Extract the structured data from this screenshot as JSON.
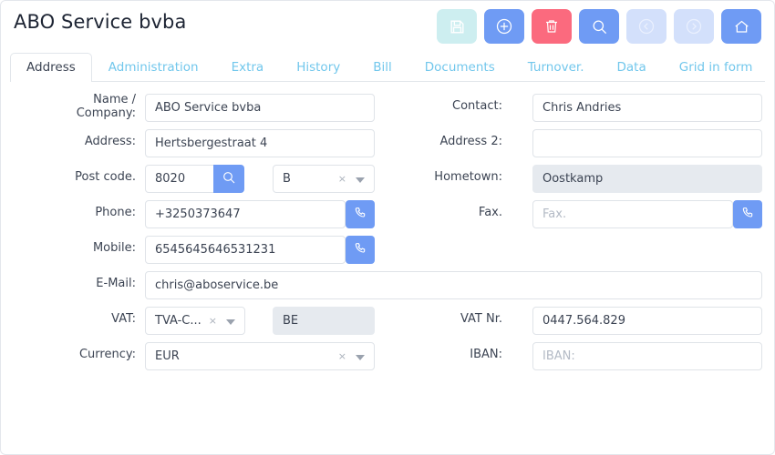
{
  "header": {
    "title": "ABO Service bvba"
  },
  "toolbar": {
    "buttons": [
      {
        "name": "save-button",
        "icon": "save-icon",
        "label": "Save",
        "state": "disabled"
      },
      {
        "name": "add-button",
        "icon": "plus-circle-icon",
        "label": "Add",
        "state": "enabled"
      },
      {
        "name": "delete-button",
        "icon": "trash-icon",
        "label": "Delete",
        "state": "enabled"
      },
      {
        "name": "search-button",
        "icon": "search-icon",
        "label": "Search",
        "state": "enabled"
      },
      {
        "name": "prev-button",
        "icon": "chevron-left-circle-icon",
        "label": "Previous",
        "state": "disabled"
      },
      {
        "name": "next-button",
        "icon": "chevron-right-circle-icon",
        "label": "Next",
        "state": "disabled"
      },
      {
        "name": "home-button",
        "icon": "home-icon",
        "label": "Home",
        "state": "enabled"
      }
    ]
  },
  "tabs": [
    {
      "label": "Address",
      "active": true
    },
    {
      "label": "Administration",
      "active": false
    },
    {
      "label": "Extra",
      "active": false
    },
    {
      "label": "History",
      "active": false
    },
    {
      "label": "Bill",
      "active": false
    },
    {
      "label": "Documents",
      "active": false
    },
    {
      "label": "Turnover.",
      "active": false
    },
    {
      "label": "Data",
      "active": false
    },
    {
      "label": "Grid in form",
      "active": false
    }
  ],
  "form": {
    "name_company": {
      "label_line1": "Name /",
      "label_line2": "Company:",
      "value": "ABO Service bvba",
      "placeholder": ""
    },
    "contact": {
      "label": "Contact:",
      "value": "Chris Andries",
      "placeholder": ""
    },
    "address": {
      "label": "Address:",
      "value": "Hertsbergestraat 4",
      "placeholder": ""
    },
    "address2": {
      "label": "Address 2:",
      "value": "",
      "placeholder": ""
    },
    "postcode": {
      "label": "Post code.",
      "value": "8020",
      "placeholder": "",
      "search_icon": "search-icon"
    },
    "country": {
      "label": "",
      "value": "B",
      "clear_glyph": "×"
    },
    "hometown": {
      "label": "Hometown:",
      "value": "Oostkamp",
      "readonly": true
    },
    "phone": {
      "label": "Phone:",
      "value": "+3250373647",
      "placeholder": "",
      "call_icon": "phone-icon"
    },
    "fax": {
      "label": "Fax.",
      "value": "",
      "placeholder": "Fax.",
      "call_icon": "phone-icon"
    },
    "mobile": {
      "label": "Mobile:",
      "value": "6545645646531231",
      "placeholder": "",
      "call_icon": "phone-icon"
    },
    "email": {
      "label": "E-Mail:",
      "value": "chris@aboservice.be",
      "placeholder": ""
    },
    "vat": {
      "label": "VAT:",
      "value": "TVA-C...",
      "clear_glyph": "×"
    },
    "vat_code": {
      "value": "BE",
      "readonly": true
    },
    "vat_nr": {
      "label": "VAT Nr.",
      "value": "0447.564.829",
      "placeholder": ""
    },
    "currency": {
      "label": "Currency:",
      "value": "EUR",
      "clear_glyph": "×"
    },
    "iban": {
      "label": "IBAN:",
      "value": "",
      "placeholder": "IBAN:"
    }
  },
  "colors": {
    "accent_blue": "#6f9bf4",
    "danger_red": "#fb6a7e",
    "save_disabled": "#cdeef0",
    "nav_disabled": "#d3e0fb",
    "tab_inactive_text": "#72c7ec",
    "readonly_bg": "#e6eaef"
  }
}
